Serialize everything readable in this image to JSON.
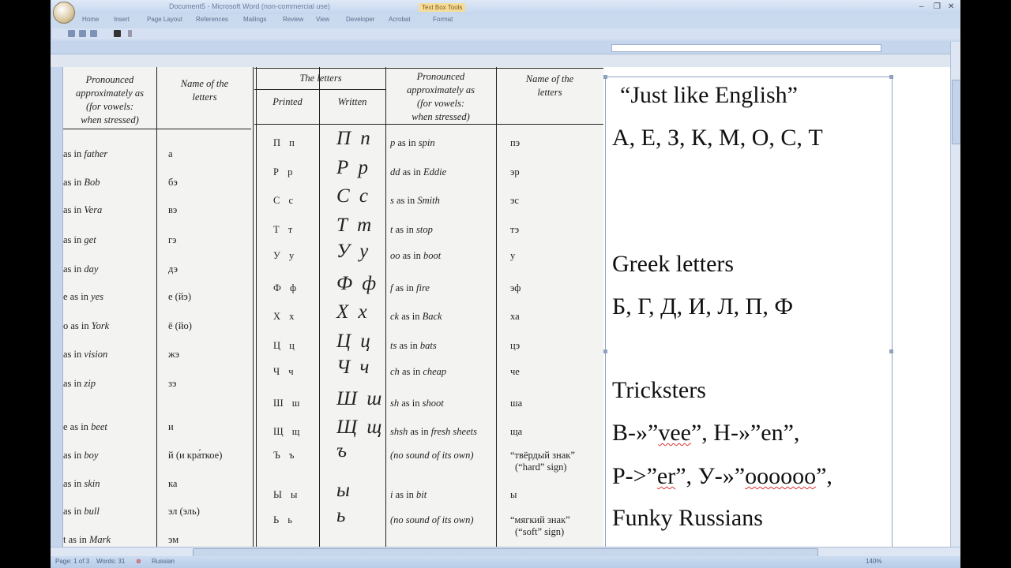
{
  "app": {
    "title": "Document5 - Microsoft Word (non-commercial use)",
    "context_tab": "Text Box Tools",
    "window_controls": [
      "–",
      "❐",
      "✕"
    ]
  },
  "ribbon": {
    "tabs": [
      "Home",
      "Insert",
      "Page Layout",
      "References",
      "Mailings",
      "Review",
      "View",
      "Developer",
      "Acrobat",
      "Format"
    ]
  },
  "scan_table": {
    "left_headers": {
      "pronounced": [
        "Pronounced",
        "approximately as",
        "(for vowels:",
        "when stressed)"
      ],
      "name": [
        "Name of the",
        "letters"
      ]
    },
    "left_rows": [
      {
        "sound_pre": "as in ",
        "sound_word": "father",
        "name": "а"
      },
      {
        "sound_pre": "as in ",
        "sound_word": "Bob",
        "name": "бэ"
      },
      {
        "sound_pre": "as in ",
        "sound_word": "Vera",
        "name": "вэ"
      },
      {
        "sound_pre": "as in ",
        "sound_word": "get",
        "name": "гэ"
      },
      {
        "sound_pre": "as in ",
        "sound_word": "day",
        "name": "дэ"
      },
      {
        "sound_pre": "e as in ",
        "sound_word": "yes",
        "name": "е (йэ)"
      },
      {
        "sound_pre": "o as in ",
        "sound_word": "York",
        "name": "ё (йо)"
      },
      {
        "sound_pre": "as in ",
        "sound_word": "vision",
        "name": "жэ"
      },
      {
        "sound_pre": "as in ",
        "sound_word": "zip",
        "name": "зэ"
      },
      {
        "sound_pre": "",
        "sound_word": "",
        "name": ""
      },
      {
        "sound_pre": "e as in ",
        "sound_word": "beet",
        "name": "и"
      },
      {
        "sound_pre": "as in ",
        "sound_word": "boy",
        "name": "й (и кра́ткое)"
      },
      {
        "sound_pre": "as in ",
        "sound_word": "skin",
        "name": "ка"
      },
      {
        "sound_pre": "as in ",
        "sound_word": "bull",
        "name": "эл (эль)"
      },
      {
        "sound_pre": "t as in ",
        "sound_word": "Mark",
        "name": "эм"
      }
    ],
    "right_headers": {
      "letters": "The letters",
      "printed": "Printed",
      "written": "Written",
      "pronounced": [
        "Pronounced",
        "approximately as",
        "(for vowels:",
        "when stressed)"
      ],
      "name": [
        "Name of the",
        "letters"
      ]
    },
    "right_rows": [
      {
        "printed": "П п",
        "written": "П п",
        "sound_pre": "p",
        "sound_mid": " as in ",
        "sound_word": "spin",
        "name": "пэ"
      },
      {
        "printed": "Р р",
        "written": "Р р",
        "sound_pre": "dd",
        "sound_mid": " as in ",
        "sound_word": "Eddie",
        "name": "эр"
      },
      {
        "printed": "С с",
        "written": "С с",
        "sound_pre": "s",
        "sound_mid": " as in ",
        "sound_word": "Smith",
        "name": "эс"
      },
      {
        "printed": "Т т",
        "written": "Т т",
        "sound_pre": "t",
        "sound_mid": " as in ",
        "sound_word": "stop",
        "name": "тэ"
      },
      {
        "printed": "У у",
        "written": "У у",
        "sound_pre": "oo",
        "sound_mid": " as in ",
        "sound_word": "boot",
        "name": "у"
      },
      {
        "printed": "Ф ф",
        "written": "Ф ф",
        "sound_pre": "f",
        "sound_mid": " as in ",
        "sound_word": "fire",
        "name": "эф"
      },
      {
        "printed": "Х х",
        "written": "Х х",
        "sound_pre": "ck",
        "sound_mid": " as in ",
        "sound_word": "Back",
        "name": "ха"
      },
      {
        "printed": "Ц ц",
        "written": "Ц ц",
        "sound_pre": "ts",
        "sound_mid": " as in ",
        "sound_word": "bats",
        "name": "цэ"
      },
      {
        "printed": "Ч ч",
        "written": "Ч ч",
        "sound_pre": "ch",
        "sound_mid": " as in ",
        "sound_word": "cheap",
        "name": "че"
      },
      {
        "printed": "Ш ш",
        "written": "Ш ш",
        "sound_pre": "sh",
        "sound_mid": " as in ",
        "sound_word": "shoot",
        "name": "ша"
      },
      {
        "printed": "Щ щ",
        "written": "Щ щ",
        "sound_pre": "shsh",
        "sound_mid": " as in ",
        "sound_word": "fresh sheets",
        "name": "ща"
      },
      {
        "printed": "Ъ ъ",
        "written": "ъ",
        "sound_pre": "(no sound of its own)",
        "sound_mid": "",
        "sound_word": "",
        "name": "“твёрдый знак”",
        "name2": "(“hard” sign)"
      },
      {
        "printed": "Ы ы",
        "written": "ы",
        "sound_pre": "i",
        "sound_mid": " as in ",
        "sound_word": "bit",
        "name": "ы"
      },
      {
        "printed": "Ь ь",
        "written": "ь",
        "sound_pre": "(no sound of its own)",
        "sound_mid": "",
        "sound_word": "",
        "name": "“мягкий знак”",
        "name2": "(“soft” sign)"
      }
    ]
  },
  "textbox": {
    "title": "“Just like English”",
    "same_letters": "А, Е, З, К, М, О, С, Т",
    "greek_heading": "Greek letters",
    "greek_letters": "Б, Г, Д, И, Л, П, Ф",
    "tricksters_heading": "Tricksters",
    "trick1_pre": "В-»”",
    "trick1_w1": "vee",
    "trick1_mid": "”, Н-»”",
    "trick1_w2": "en",
    "trick1_end": "”,",
    "trick2_pre": "Р->”",
    "trick2_w1": "er",
    "trick2_mid": "”, У-»”",
    "trick2_w2": "oooooo",
    "trick2_end": "”,",
    "funky": "Funky Russians"
  },
  "status": {
    "page": "Page: 1 of 3",
    "words": "Words: 31",
    "language": "Russian",
    "zoom": "140%"
  }
}
